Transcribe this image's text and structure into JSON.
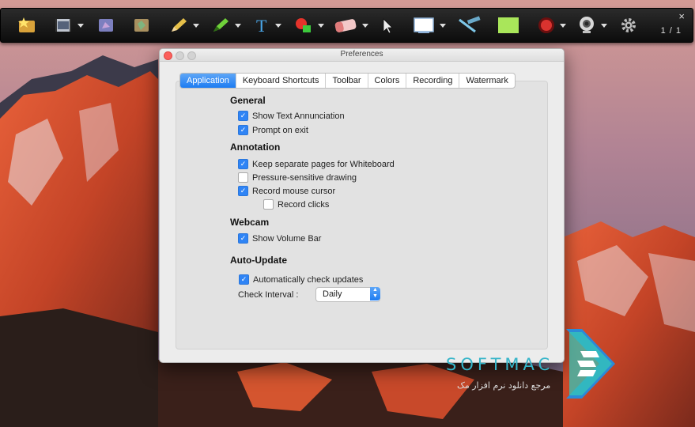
{
  "toolbar": {
    "icons": [
      "star-folder",
      "film",
      "hand",
      "book",
      "pencil",
      "highlighter",
      "text",
      "shapes",
      "eraser",
      "pointer",
      "screen",
      "line",
      "green-rect",
      "record",
      "webcam",
      "gear"
    ],
    "close_label": "×",
    "page_indicator": "1 / 1"
  },
  "window": {
    "title": "Preferences",
    "tabs": [
      "Application",
      "Keyboard Shortcuts",
      "Toolbar",
      "Colors",
      "Recording",
      "Watermark"
    ],
    "active_tab": "Application"
  },
  "sections": {
    "general": {
      "title": "General",
      "options": [
        {
          "label": "Show Text Annunciation",
          "checked": true
        },
        {
          "label": "Prompt on exit",
          "checked": true
        }
      ]
    },
    "annotation": {
      "title": "Annotation",
      "options": [
        {
          "label": "Keep separate pages for Whiteboard",
          "checked": true
        },
        {
          "label": "Pressure-sensitive drawing",
          "checked": false
        },
        {
          "label": "Record mouse cursor",
          "checked": true
        },
        {
          "label": "Record clicks",
          "checked": false
        }
      ]
    },
    "webcam": {
      "title": "Webcam",
      "options": [
        {
          "label": "Show Volume Bar",
          "checked": true
        }
      ]
    },
    "autoupdate": {
      "title": "Auto-Update",
      "options": [
        {
          "label": "Automatically check updates",
          "checked": true
        }
      ],
      "interval_label": "Check Interval :",
      "interval_value": "Daily"
    }
  },
  "watermark": {
    "brand": "SOFTMAC",
    "tagline": "مرجع دانلود نرم افزار مک"
  },
  "colors": {
    "accent": "#1d7cf2",
    "watermark": "#35b5c9"
  }
}
